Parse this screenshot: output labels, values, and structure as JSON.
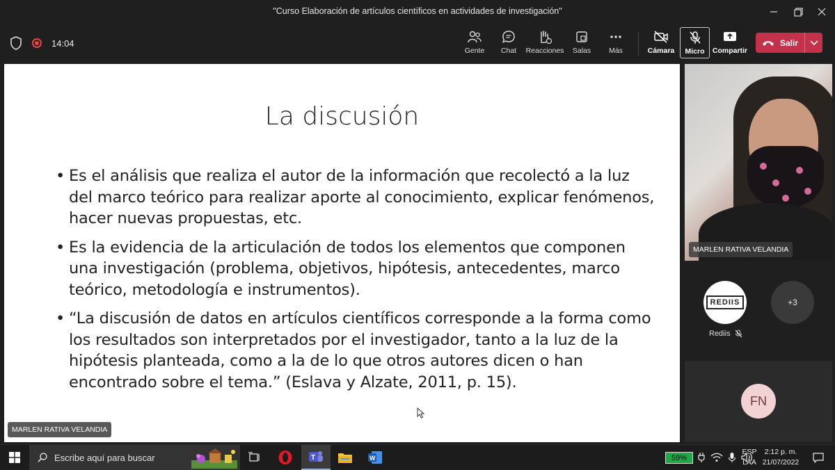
{
  "window": {
    "title": "\"Curso Elaboración de artículos científicos en actividades de investigación\""
  },
  "toolbar": {
    "time": "14:04",
    "buttons": {
      "people": "Gente",
      "chat": "Chat",
      "reactions": "Reacciones",
      "rooms": "Salas",
      "more": "Más",
      "camera": "Cámara",
      "mic": "Micro",
      "share": "Compartir"
    },
    "leave_label": "Salir"
  },
  "slide": {
    "title": "La discusión",
    "bullets": [
      "Es el análisis que realiza el autor de la información que recolectó a la luz del marco teórico para realizar aporte al conocimiento, explicar fenómenos, hacer nuevas propuestas, etc.",
      "Es la evidencia de la articulación de todos los elementos que componen una investigación (problema, objetivos, hipótesis, antecedentes, marco teórico, metodología e instrumentos).",
      "“La discusión de datos en artículos científicos corresponde a la forma como los resultados son interpretados por el investigador, tanto a la luz de la hipótesis planteada, como a la de lo que otros autores dicen o han encontrado sobre el tema.” (Eslava y Alzate, 2011, p. 15)."
    ],
    "presenter_name": "MARLEN RATIVA VELANDIA"
  },
  "participants": {
    "video_name": "MARLEN RATIVA VELANDIA",
    "rediis_logo_text": "REDIIS",
    "rediis_name": "Rediis",
    "overflow_count": "+3",
    "fn_initials": "FN"
  },
  "taskbar": {
    "search_placeholder": "Escribe aquí para buscar",
    "battery": "59%",
    "lang_top": "ESP",
    "lang_bottom": "LAA",
    "time": "2:12 p. m.",
    "date": "21/07/2022"
  },
  "colors": {
    "leave_button": "#c4314b",
    "battery": "#1fa84a",
    "fn_avatar_bg": "#f3d2d4"
  }
}
